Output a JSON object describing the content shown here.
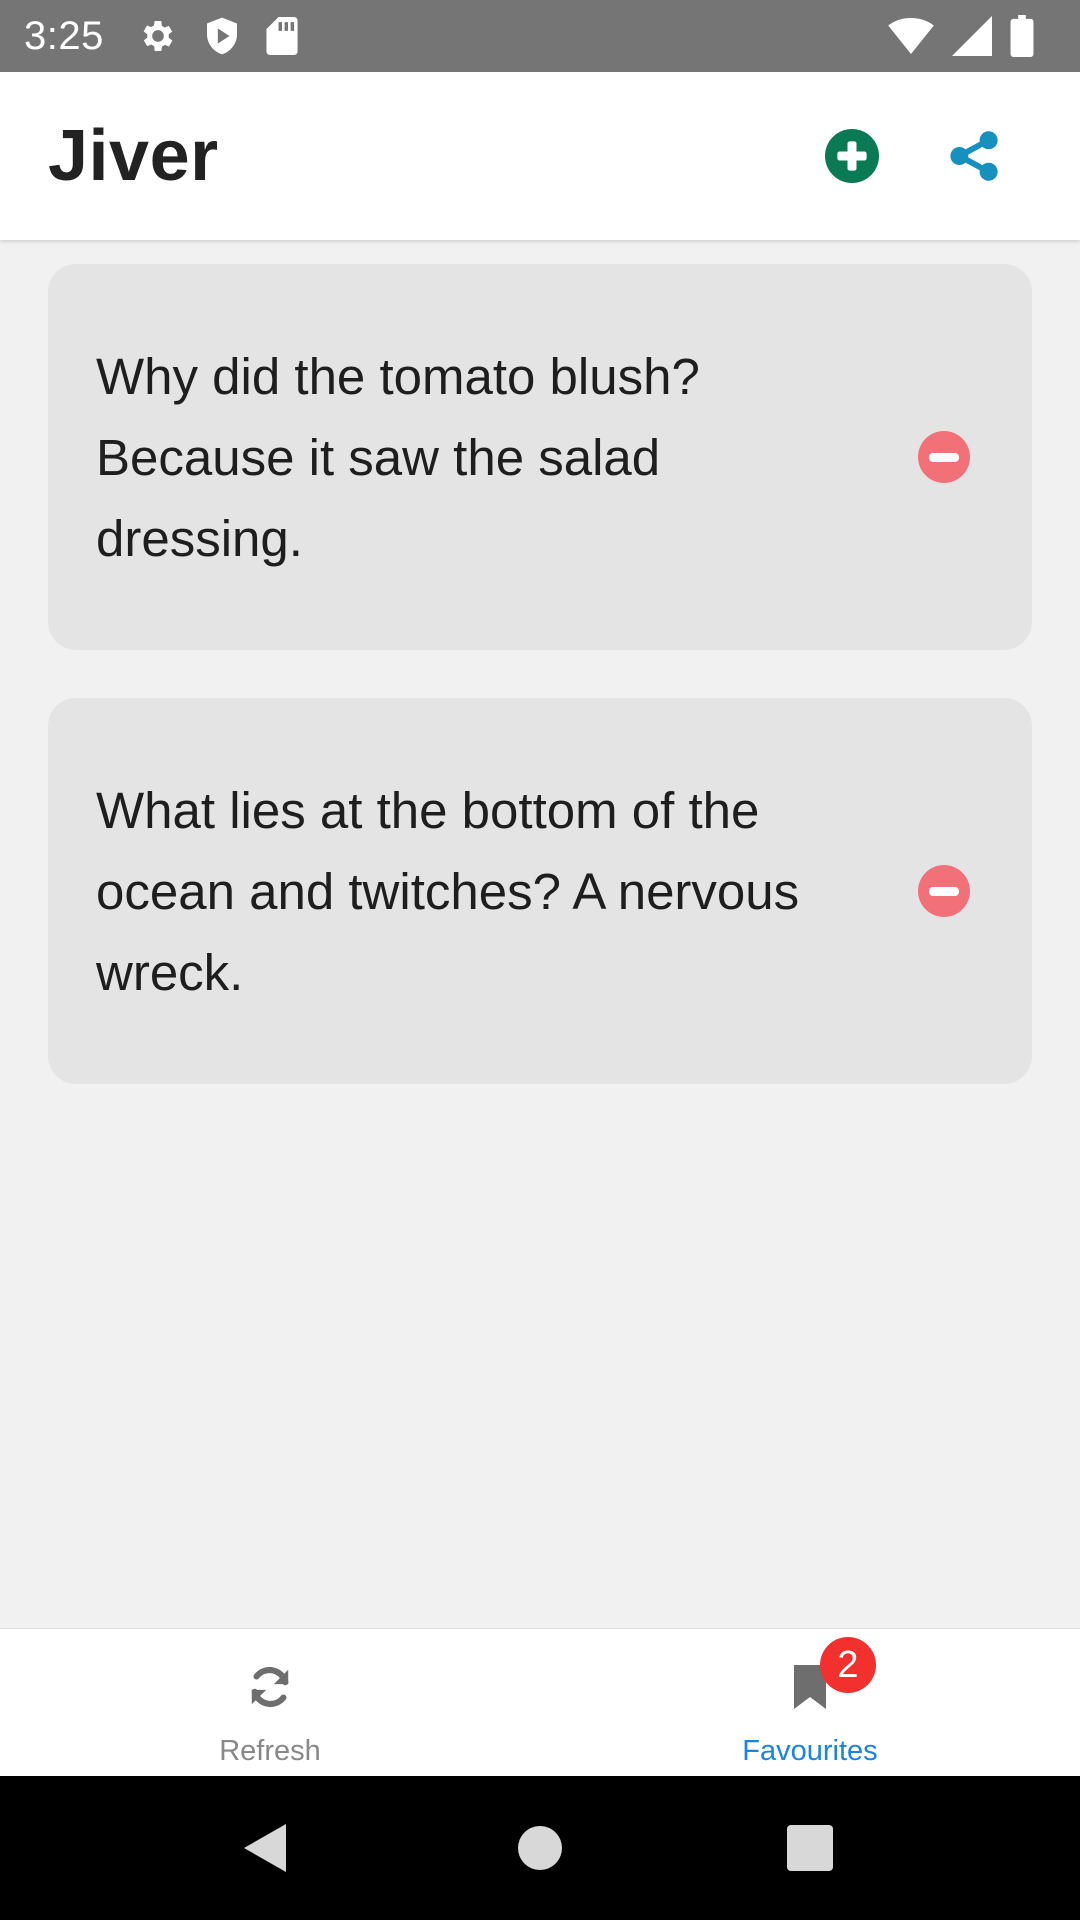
{
  "status_bar": {
    "time": "3:25",
    "left_icons": [
      "settings-icon",
      "shield-play-icon",
      "sd-card-icon"
    ],
    "right_icons": [
      "wifi-icon",
      "cell-signal-icon",
      "battery-icon"
    ],
    "background": "#757575"
  },
  "app_bar": {
    "title": "Jiver",
    "actions": [
      {
        "icon": "add-circle-icon",
        "color": "#0a7a55"
      },
      {
        "icon": "share-icon",
        "color": "#1790c0"
      }
    ]
  },
  "jokes": [
    {
      "text": "Why did the tomato blush? Because it saw the salad dressing.",
      "action_icon": "remove-circle-icon"
    },
    {
      "text": "What lies at the bottom of the ocean and twitches? A nervous wreck.",
      "action_icon": "remove-circle-icon"
    }
  ],
  "bottom_nav": {
    "items": [
      {
        "label": "Refresh",
        "icon": "refresh-icon",
        "active": false
      },
      {
        "label": "Favourites",
        "icon": "bookmark-icon",
        "active": true,
        "badge": "2"
      }
    ],
    "active_color": "#1a84e6",
    "inactive_color": "#888888",
    "badge_color": "#f2312f"
  },
  "system_nav": {
    "buttons": [
      "back-icon",
      "home-icon",
      "recents-icon"
    ]
  }
}
